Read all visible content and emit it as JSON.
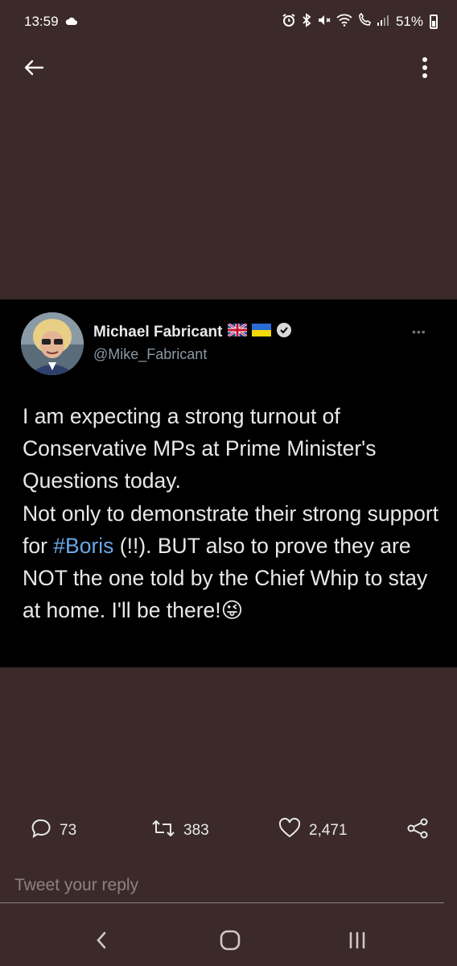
{
  "status_bar": {
    "time": "13:59",
    "battery_percent": "51%",
    "icons": [
      "cloud-icon",
      "alarm-icon",
      "bluetooth-icon",
      "mute-icon",
      "wifi-icon",
      "wifi-calling-icon",
      "signal-icon",
      "battery-icon"
    ]
  },
  "top_bar": {
    "back_icon": "back-arrow-icon",
    "menu_icon": "more-vertical-icon"
  },
  "tweet": {
    "author_name": "Michael Fabricant",
    "flags": [
      "uk-flag-icon",
      "ukraine-flag-icon"
    ],
    "verified": true,
    "handle": "@Mike_Fabricant",
    "text_before": "I am expecting a strong turnout of Conservative MPs at Prime Minister's Questions today.\nNot only to demonstrate their strong support for ",
    "hashtag": "#Boris",
    "text_after": " (!!). BUT also to prove they are NOT the one told by the Chief Whip to stay at home.  I'll be there!",
    "emoji": "😜",
    "accent_color": "#6aa8e8"
  },
  "actions": {
    "replies": "73",
    "retweets": "383",
    "likes": "2,471"
  },
  "reply": {
    "placeholder": "Tweet your reply"
  },
  "nav_bar": {
    "buttons": [
      "back-nav-icon",
      "home-nav-icon",
      "recents-nav-icon"
    ]
  }
}
